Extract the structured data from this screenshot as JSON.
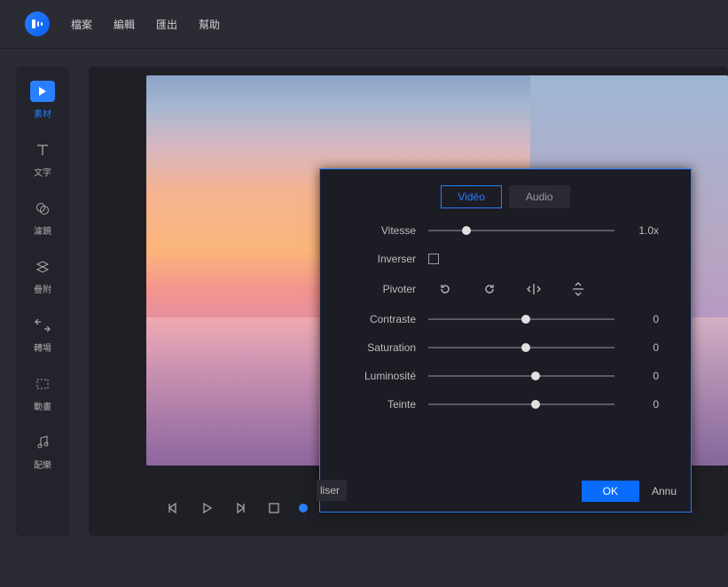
{
  "menu": {
    "file": "檔案",
    "edit": "編輯",
    "export": "匯出",
    "help": "幫助"
  },
  "sidebar": {
    "items": [
      {
        "label": "素材",
        "icon": "media-icon"
      },
      {
        "label": "文字",
        "icon": "text-icon"
      },
      {
        "label": "濾鏡",
        "icon": "filter-icon"
      },
      {
        "label": "疊附",
        "icon": "overlay-icon"
      },
      {
        "label": "轉場",
        "icon": "transition-icon"
      },
      {
        "label": "動畫",
        "icon": "animation-icon"
      },
      {
        "label": "配樂",
        "icon": "music-icon"
      }
    ]
  },
  "modal": {
    "tabs": {
      "video": "Vidéo",
      "audio": "Audio"
    },
    "speed": {
      "label": "Vitesse",
      "value": "1.0x",
      "pos": 18
    },
    "reverse": {
      "label": "Inverser"
    },
    "rotate": {
      "label": "Pivoter"
    },
    "contrast": {
      "label": "Contraste",
      "value": "0",
      "pos": 50
    },
    "saturation": {
      "label": "Saturation",
      "value": "0",
      "pos": 50
    },
    "brightness": {
      "label": "Luminosité",
      "value": "0",
      "pos": 55
    },
    "tint": {
      "label": "Teinte",
      "value": "0",
      "pos": 55
    },
    "footer": {
      "ok": "OK",
      "cancel_frag": "Annu",
      "left_frag": "liser"
    }
  }
}
